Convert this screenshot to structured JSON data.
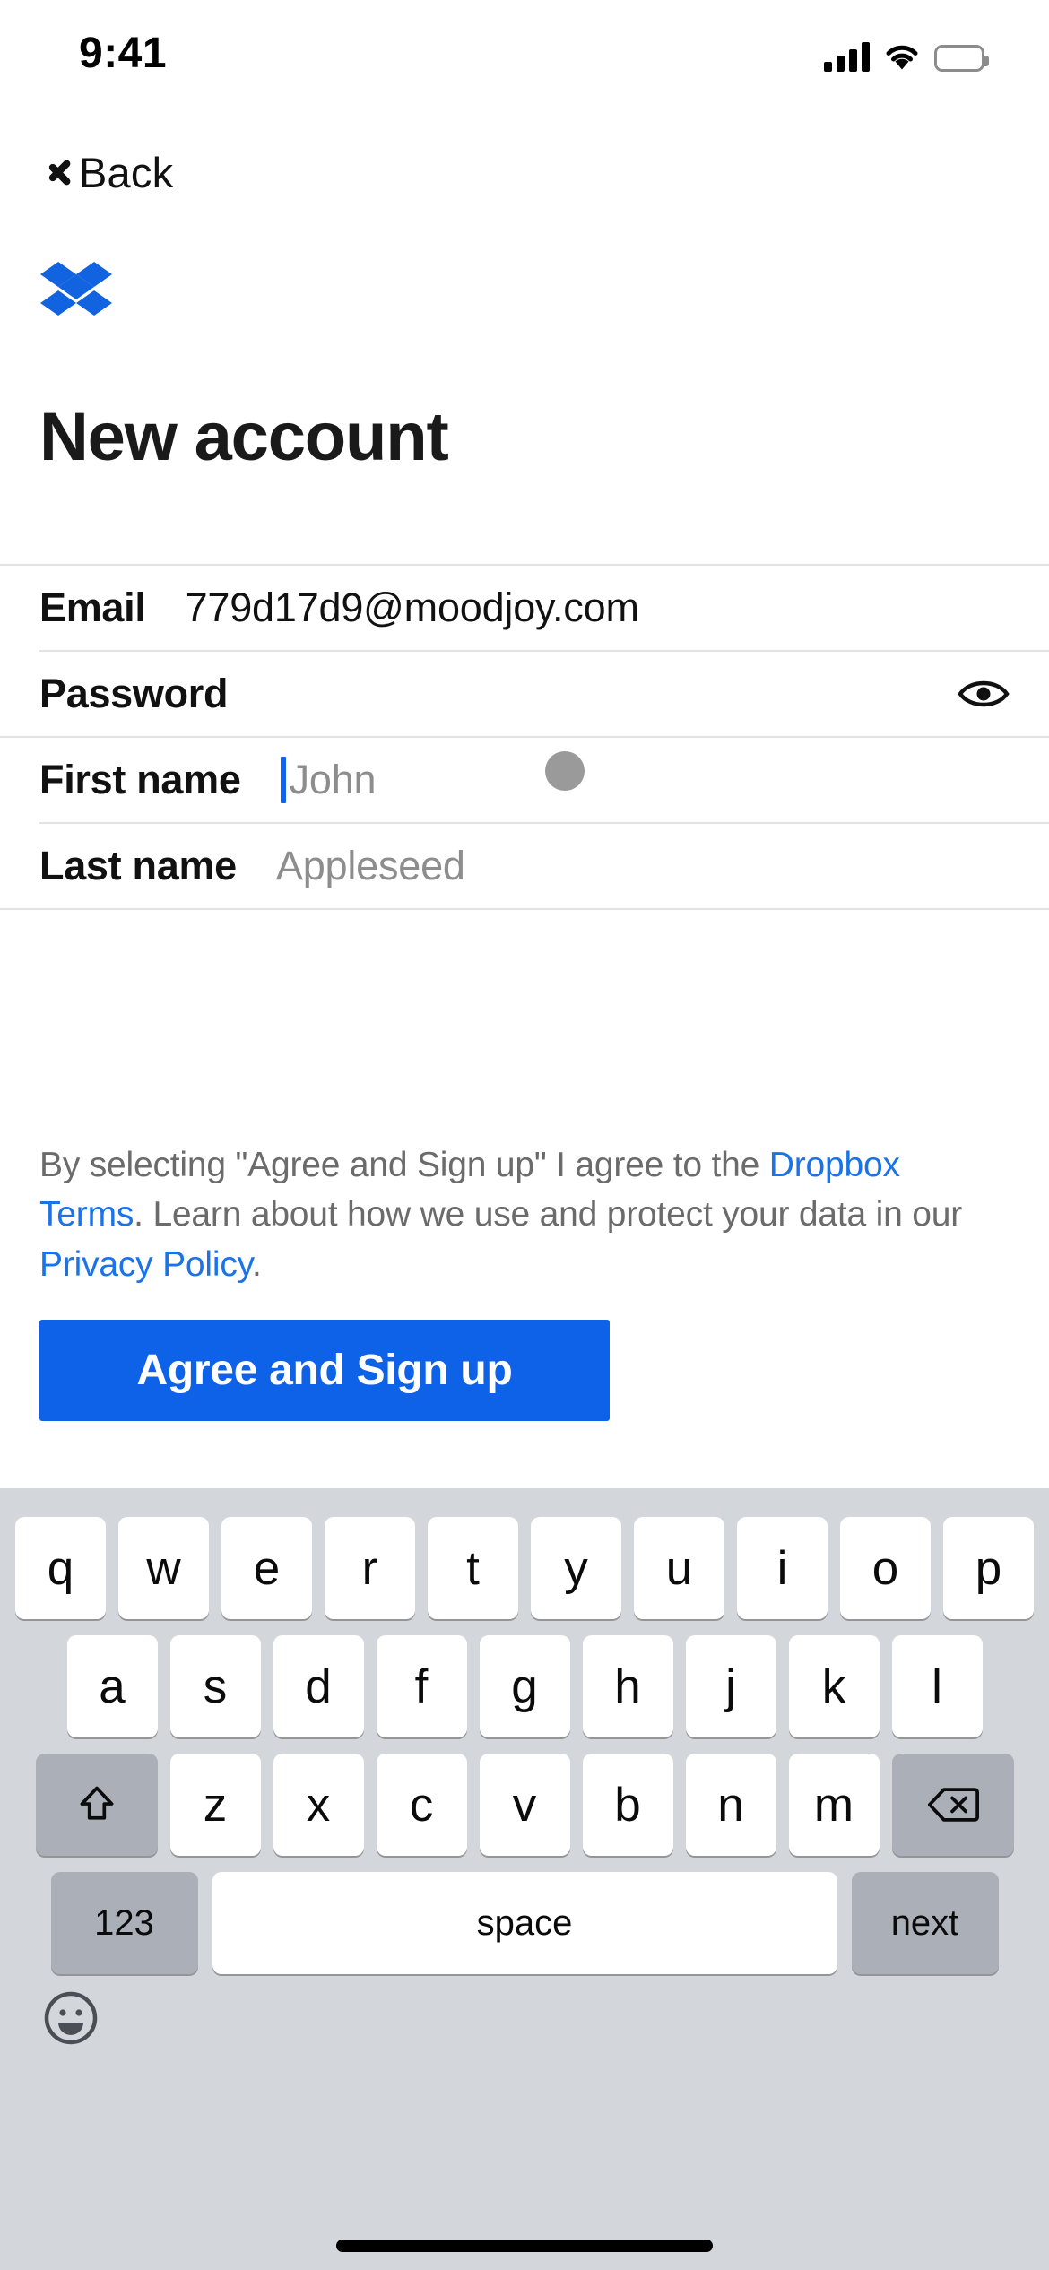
{
  "status_bar": {
    "time": "9:41",
    "cellular_icon": "cellular-signal-icon",
    "wifi_icon": "wifi-icon",
    "battery_icon": "battery-full-icon"
  },
  "nav": {
    "back_label": "Back",
    "back_icon": "chevron-left-icon"
  },
  "brand": {
    "logo_icon": "dropbox-logo-icon",
    "logo_color": "#1263e0"
  },
  "header": {
    "title": "New account"
  },
  "form": {
    "fields": [
      {
        "label": "Email",
        "value": "779d17d9@moodjoy.com",
        "placeholder": "",
        "state": "filled"
      },
      {
        "label": "Password",
        "value": "",
        "placeholder": "",
        "state": "empty",
        "trailing_icon": "eye-show-password-icon"
      },
      {
        "label": "First name",
        "value": "",
        "placeholder": "John",
        "state": "focused"
      },
      {
        "label": "Last name",
        "value": "",
        "placeholder": "Appleseed",
        "state": "empty"
      }
    ]
  },
  "legal": {
    "part1": "By selecting \"Agree and Sign up\" I agree to the ",
    "link1": "Dropbox Terms",
    "part2": ". Learn about how we use and protect your data in our ",
    "link2": "Privacy Policy",
    "part3": ".",
    "link_color": "#1a73e8"
  },
  "cta": {
    "label": "Agree and Sign up",
    "background": "#0d62e8",
    "text_color": "#ffffff"
  },
  "keyboard": {
    "row1": [
      "q",
      "w",
      "e",
      "r",
      "t",
      "y",
      "u",
      "i",
      "o",
      "p"
    ],
    "row2": [
      "a",
      "s",
      "d",
      "f",
      "g",
      "h",
      "j",
      "k",
      "l"
    ],
    "row3": [
      "z",
      "x",
      "c",
      "v",
      "b",
      "n",
      "m"
    ],
    "shift_icon": "shift-arrow-up-icon",
    "backspace_icon": "backspace-delete-icon",
    "numbers_key": "123",
    "space_key": "space",
    "return_key": "next",
    "emoji_icon": "emoji-smiley-icon",
    "background": "#d3d6da"
  },
  "home_indicator": "home-indicator-bar"
}
